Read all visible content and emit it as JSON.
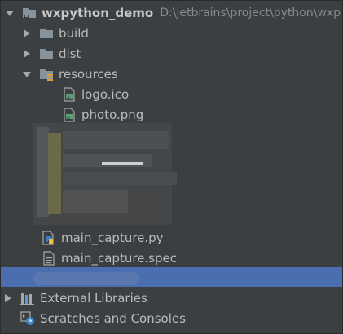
{
  "tree": {
    "project": {
      "name": "wxpython_demo",
      "path": "D:\\jetbrains\\project\\python\\wxp"
    },
    "items": [
      {
        "label": "build"
      },
      {
        "label": "dist"
      },
      {
        "label": "resources"
      },
      {
        "label": "logo.ico"
      },
      {
        "label": "photo.png"
      },
      {
        "label": "main_capture.py"
      },
      {
        "label": "main_capture.spec"
      }
    ],
    "external_libraries": "External Libraries",
    "scratches": "Scratches and Consoles"
  },
  "colors": {
    "background": "#3c3f41",
    "selection": "#4b6eaf",
    "folder": "#87939a",
    "text": "#bbbbbb"
  }
}
